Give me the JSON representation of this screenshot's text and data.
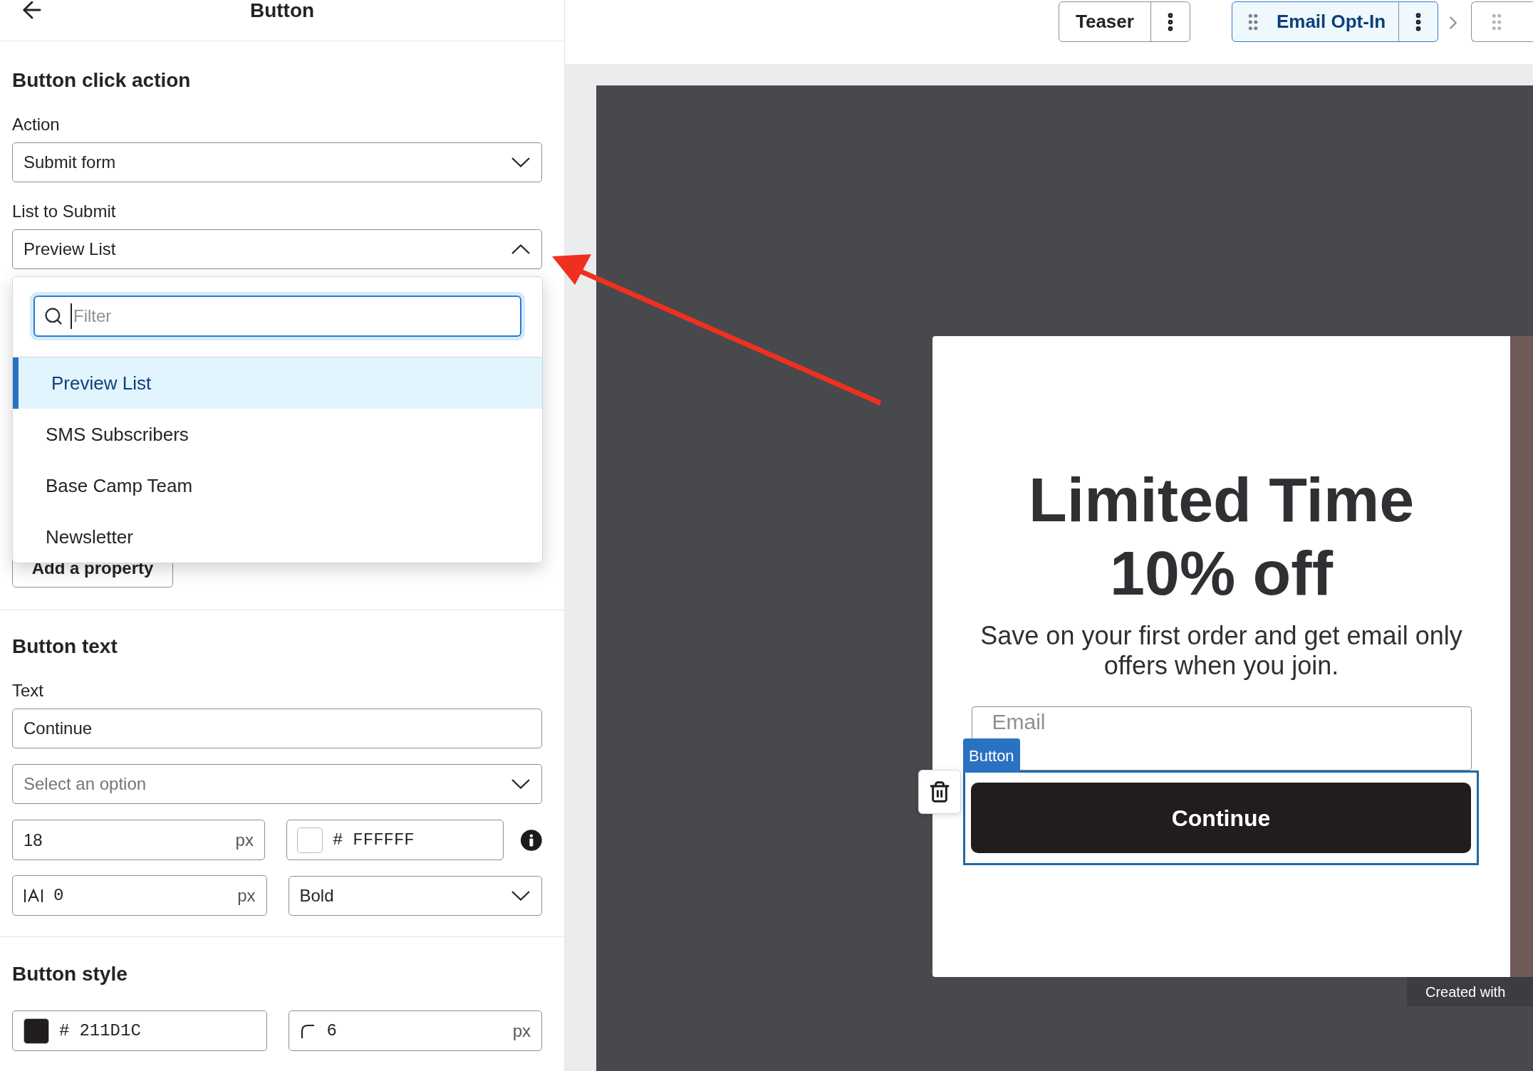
{
  "header": {
    "title": "Button"
  },
  "click_action": {
    "heading": "Button click action",
    "action": {
      "label": "Action",
      "value": "Submit form"
    },
    "list": {
      "label": "List to Submit",
      "value": "Preview List",
      "expanded": true,
      "filter_placeholder": "Filter",
      "options": [
        {
          "label": "Preview List",
          "selected": true
        },
        {
          "label": "SMS Subscribers",
          "selected": false
        },
        {
          "label": "Base Camp Team",
          "selected": false
        },
        {
          "label": "Newsletter",
          "selected": false
        }
      ]
    },
    "add_property": "Add a property"
  },
  "button_text": {
    "heading": "Button text",
    "text": {
      "label": "Text",
      "value": "Continue"
    },
    "font": {
      "placeholder": "Select an option"
    },
    "size": {
      "value": "18",
      "unit": "px"
    },
    "color": {
      "prefix": "#",
      "value": "FFFFFF"
    },
    "spacing": {
      "value": "0",
      "unit": "px"
    },
    "weight": {
      "value": "Bold"
    }
  },
  "button_style": {
    "heading": "Button style",
    "background": {
      "prefix": "#",
      "value": "211D1C"
    },
    "radius": {
      "value": "6",
      "unit": "px"
    }
  },
  "steps": [
    {
      "label": "Teaser",
      "selected": false
    },
    {
      "label": "Email Opt-In",
      "selected": true
    }
  ],
  "popup": {
    "headline": [
      "Limited Time",
      "10% off"
    ],
    "body": "Save on your first order and get email only offers when you join.",
    "email_placeholder": "Email",
    "selection_tag": "Button",
    "button": "Continue",
    "credit": "Created with"
  }
}
